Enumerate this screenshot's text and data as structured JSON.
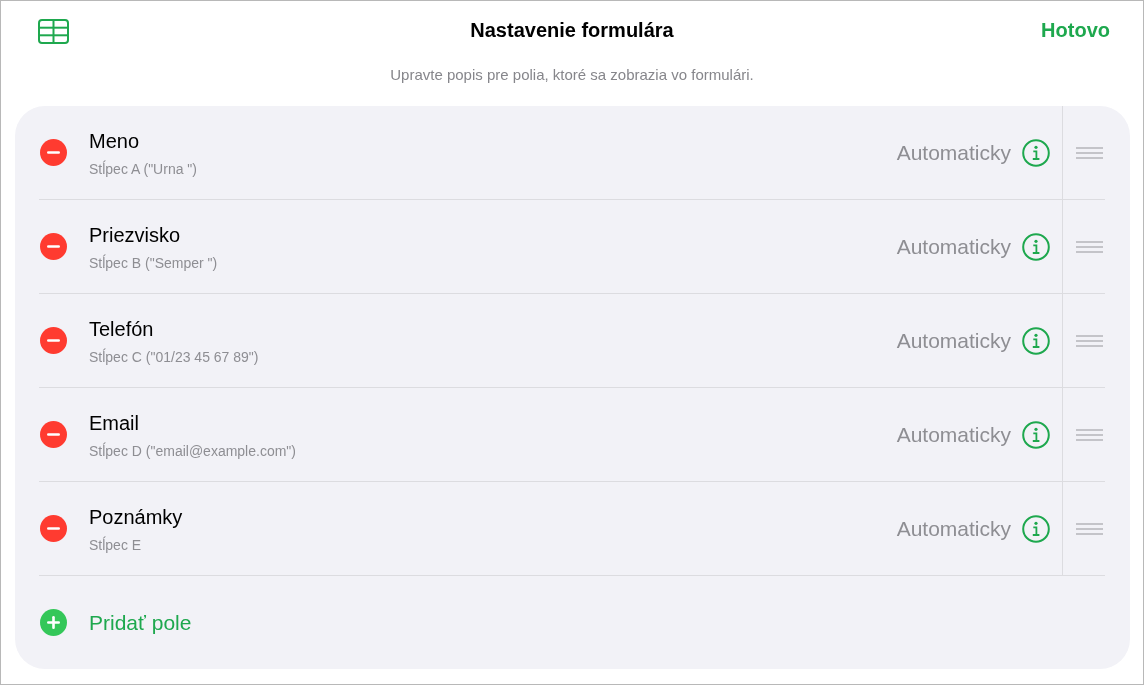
{
  "header": {
    "title": "Nastavenie formulára",
    "done_button": "Hotovo",
    "subtitle": "Upravte popis pre polia, ktoré sa zobrazia vo formulári."
  },
  "fields": [
    {
      "name": "Meno",
      "column": "Stĺpec A (\"Urna \")",
      "setting": "Automaticky"
    },
    {
      "name": "Priezvisko",
      "column": "Stĺpec B (\"Semper \")",
      "setting": "Automaticky"
    },
    {
      "name": "Telefón",
      "column": "Stĺpec C (\"01/23 45 67 89\")",
      "setting": "Automaticky"
    },
    {
      "name": "Email",
      "column": "Stĺpec D (\"email@example.com\")",
      "setting": "Automaticky"
    },
    {
      "name": "Poznámky",
      "column": "Stĺpec E",
      "setting": "Automaticky"
    }
  ],
  "add_field": {
    "label": "Pridať pole"
  }
}
